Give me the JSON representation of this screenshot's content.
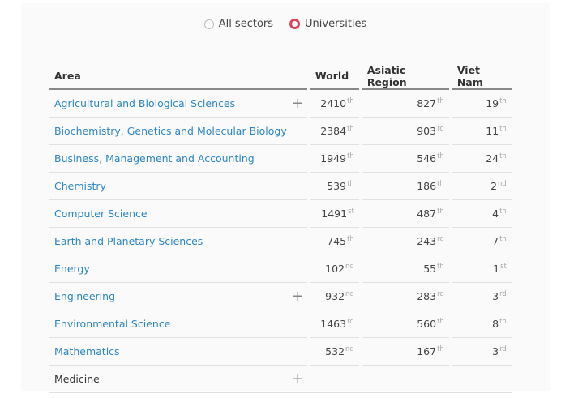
{
  "filter": {
    "options": [
      {
        "label": "All sectors",
        "selected": false
      },
      {
        "label": "Universities",
        "selected": true
      }
    ]
  },
  "table": {
    "headers": {
      "area": "Area",
      "world": "World",
      "region": "Asiatic Region",
      "country": "Viet Nam"
    },
    "rows": [
      {
        "area": "Agricultural and Biological Sciences",
        "link": true,
        "expand": "+",
        "world": "2410",
        "world_sfx": "th",
        "region": "827",
        "region_sfx": "th",
        "country": "19",
        "country_sfx": "th"
      },
      {
        "area": "Biochemistry, Genetics and Molecular Biology",
        "link": true,
        "expand": "",
        "world": "2384",
        "world_sfx": "th",
        "region": "903",
        "region_sfx": "rd",
        "country": "11",
        "country_sfx": "th"
      },
      {
        "area": "Business, Management and Accounting",
        "link": true,
        "expand": "",
        "world": "1949",
        "world_sfx": "th",
        "region": "546",
        "region_sfx": "th",
        "country": "24",
        "country_sfx": "th"
      },
      {
        "area": "Chemistry",
        "link": true,
        "expand": "",
        "world": "539",
        "world_sfx": "th",
        "region": "186",
        "region_sfx": "th",
        "country": "2",
        "country_sfx": "nd"
      },
      {
        "area": "Computer Science",
        "link": true,
        "expand": "",
        "world": "1491",
        "world_sfx": "st",
        "region": "487",
        "region_sfx": "th",
        "country": "4",
        "country_sfx": "th"
      },
      {
        "area": "Earth and Planetary Sciences",
        "link": true,
        "expand": "",
        "world": "745",
        "world_sfx": "th",
        "region": "243",
        "region_sfx": "rd",
        "country": "7",
        "country_sfx": "th"
      },
      {
        "area": "Energy",
        "link": true,
        "expand": "",
        "world": "102",
        "world_sfx": "nd",
        "region": "55",
        "region_sfx": "th",
        "country": "1",
        "country_sfx": "st"
      },
      {
        "area": "Engineering",
        "link": true,
        "expand": "+",
        "world": "932",
        "world_sfx": "nd",
        "region": "283",
        "region_sfx": "rd",
        "country": "3",
        "country_sfx": "rd"
      },
      {
        "area": "Environmental Science",
        "link": true,
        "expand": "",
        "world": "1463",
        "world_sfx": "rd",
        "region": "560",
        "region_sfx": "th",
        "country": "8",
        "country_sfx": "th"
      },
      {
        "area": "Mathematics",
        "link": true,
        "expand": "",
        "world": "532",
        "world_sfx": "nd",
        "region": "167",
        "region_sfx": "th",
        "country": "3",
        "country_sfx": "rd"
      },
      {
        "area": "Medicine",
        "link": false,
        "expand": "+",
        "world": "",
        "world_sfx": "",
        "region": "",
        "region_sfx": "",
        "country": "",
        "country_sfx": ""
      }
    ]
  },
  "colors": {
    "link": "#2d86c4",
    "radio_selected": "#e0445a"
  }
}
